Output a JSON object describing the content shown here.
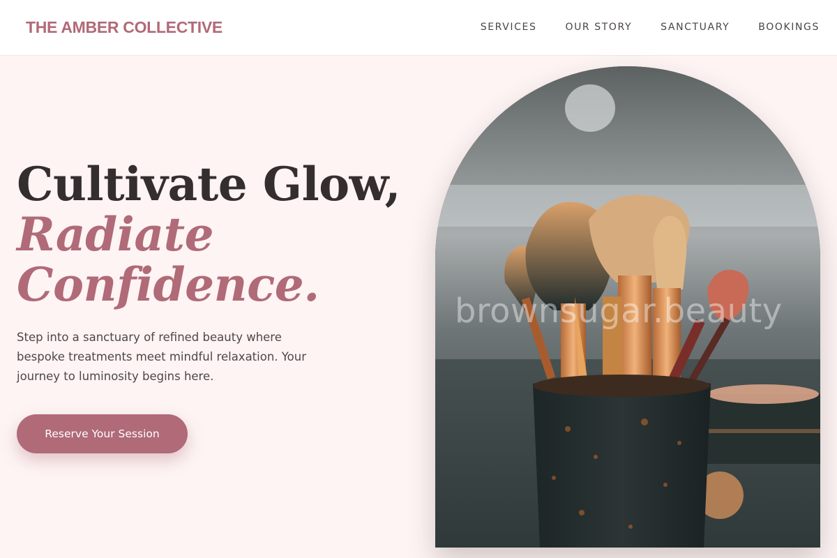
{
  "brand": {
    "name": "THE AMBER COLLECTIVE"
  },
  "nav": {
    "items": [
      "SERVICES",
      "OUR STORY",
      "SANCTUARY",
      "BOOKINGS"
    ]
  },
  "hero": {
    "headline_line1": "Cultivate Glow,",
    "headline_line2": "Radiate",
    "headline_line3": "Confidence.",
    "lead": "Step into a sanctuary of refined beauty where bespoke treatments meet mindful relaxation. Your journey to luminosity begins here.",
    "cta_label": "Reserve Your Session"
  },
  "image": {
    "subject": "makeup brushes in a cup",
    "watermark": "brownsugar.beauty"
  },
  "colors": {
    "accent": "#b06a78",
    "background": "#fdf4f3",
    "header": "#ffffff",
    "text": "#342e2f"
  }
}
